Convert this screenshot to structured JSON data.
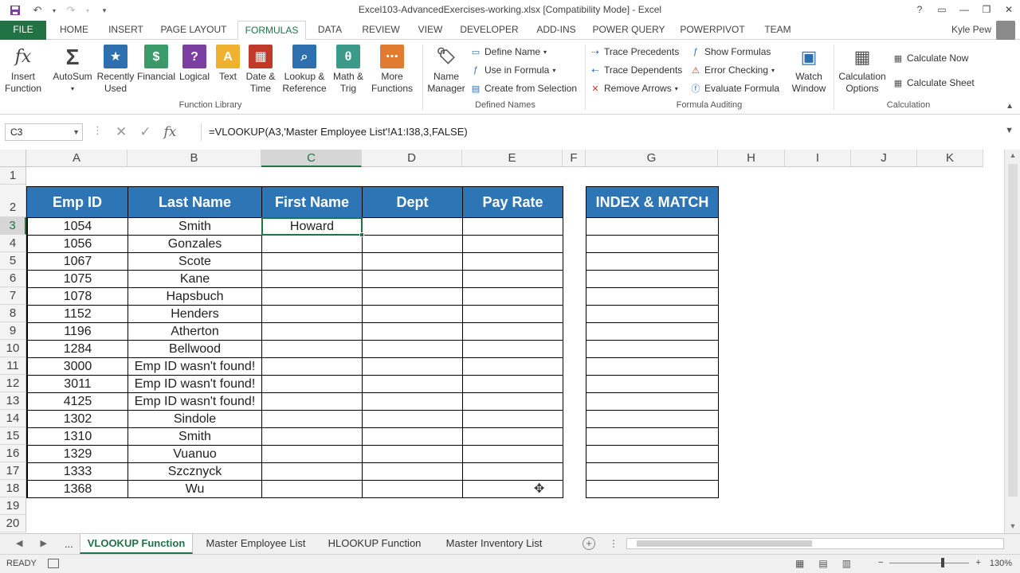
{
  "window": {
    "title": "Excel103-AdvancedExercises-working.xlsx  [Compatibility Mode] - Excel",
    "user": "Kyle Pew"
  },
  "quick_access": [
    "save-icon",
    "undo-icon",
    "redo-icon",
    "customize-icon"
  ],
  "ribbon_tabs": [
    "FILE",
    "HOME",
    "INSERT",
    "PAGE LAYOUT",
    "FORMULAS",
    "DATA",
    "REVIEW",
    "VIEW",
    "DEVELOPER",
    "ADD-INS",
    "POWER QUERY",
    "POWERPIVOT",
    "TEAM"
  ],
  "active_tab": "FORMULAS",
  "ribbon": {
    "function_library": {
      "label": "Function Library",
      "buttons": {
        "insert_function": "Insert\nFunction",
        "autosum": "AutoSum",
        "recently_used": "Recently\nUsed",
        "financial": "Financial",
        "logical": "Logical",
        "text": "Text",
        "date_time": "Date &\nTime",
        "lookup_reference": "Lookup &\nReference",
        "math_trig": "Math &\nTrig",
        "more_functions": "More\nFunctions"
      }
    },
    "defined_names": {
      "label": "Defined Names",
      "name_manager": "Name\nManager",
      "define_name": "Define Name",
      "use_in_formula": "Use in Formula",
      "create_from_selection": "Create from Selection"
    },
    "formula_auditing": {
      "label": "Formula Auditing",
      "trace_precedents": "Trace Precedents",
      "trace_dependents": "Trace Dependents",
      "remove_arrows": "Remove Arrows",
      "show_formulas": "Show Formulas",
      "error_checking": "Error Checking",
      "evaluate_formula": "Evaluate Formula",
      "watch_window": "Watch\nWindow"
    },
    "calculation": {
      "label": "Calculation",
      "calculation_options": "Calculation\nOptions",
      "calculate_now": "Calculate Now",
      "calculate_sheet": "Calculate Sheet"
    }
  },
  "formula_bar": {
    "name_box": "C3",
    "formula": "=VLOOKUP(A3,'Master Employee List'!A1:I38,3,FALSE)"
  },
  "columns": [
    "A",
    "B",
    "C",
    "D",
    "E",
    "F",
    "G",
    "H",
    "I",
    "J",
    "K"
  ],
  "rows": [
    "1",
    "2",
    "3",
    "4",
    "5",
    "6",
    "7",
    "8",
    "9",
    "10",
    "11",
    "12",
    "13",
    "14",
    "15",
    "16",
    "17",
    "18",
    "19",
    "20"
  ],
  "table": {
    "headers": [
      "Emp ID",
      "Last Name",
      "First Name",
      "Dept",
      "Pay Rate"
    ],
    "index_match_header": "INDEX & MATCH",
    "rows": [
      [
        "1054",
        "Smith",
        "Howard",
        "",
        ""
      ],
      [
        "1056",
        "Gonzales",
        "",
        "",
        ""
      ],
      [
        "1067",
        "Scote",
        "",
        "",
        ""
      ],
      [
        "1075",
        "Kane",
        "",
        "",
        ""
      ],
      [
        "1078",
        "Hapsbuch",
        "",
        "",
        ""
      ],
      [
        "1152",
        "Henders",
        "",
        "",
        ""
      ],
      [
        "1196",
        "Atherton",
        "",
        "",
        ""
      ],
      [
        "1284",
        "Bellwood",
        "",
        "",
        ""
      ],
      [
        "3000",
        "Emp ID wasn't found!",
        "",
        "",
        ""
      ],
      [
        "3011",
        "Emp ID wasn't found!",
        "",
        "",
        ""
      ],
      [
        "4125",
        "Emp ID wasn't found!",
        "",
        "",
        ""
      ],
      [
        "1302",
        "Sindole",
        "",
        "",
        ""
      ],
      [
        "1310",
        "Smith",
        "",
        "",
        ""
      ],
      [
        "1329",
        "Vuanuo",
        "",
        "",
        ""
      ],
      [
        "1333",
        "Szcznyck",
        "",
        "",
        ""
      ],
      [
        "1368",
        "Wu",
        "",
        "",
        ""
      ]
    ]
  },
  "sheet_tabs": [
    "VLOOKUP Function",
    "Master Employee List",
    "HLOOKUP Function",
    "Master Inventory List"
  ],
  "sheet_nav": {
    "ellipsis": "..."
  },
  "active_sheet": "VLOOKUP Function",
  "status": {
    "mode": "READY",
    "zoom": "130%"
  },
  "colors": {
    "accent": "#217346",
    "header_fill": "#2e75b5"
  }
}
